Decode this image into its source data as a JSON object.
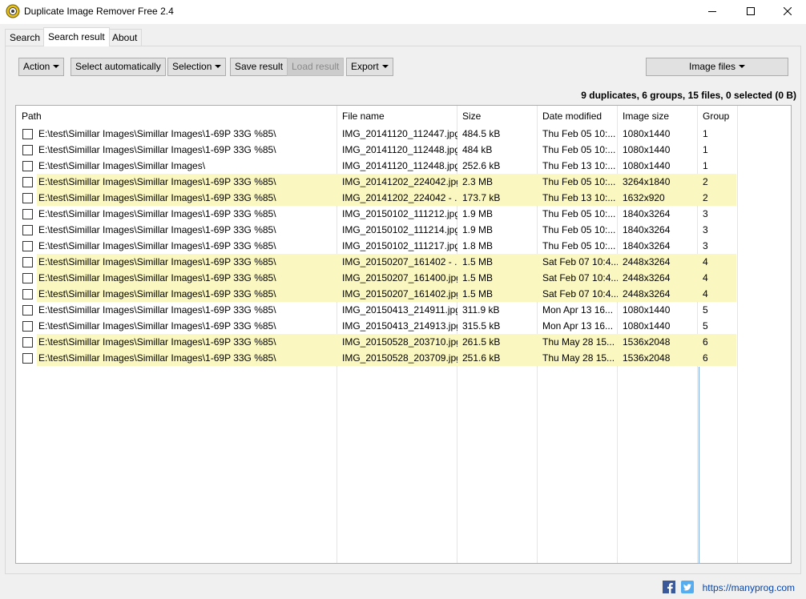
{
  "window": {
    "title": "Duplicate Image Remover Free 2.4"
  },
  "tabs": [
    {
      "label": "Search"
    },
    {
      "label": "Search result"
    },
    {
      "label": "About"
    }
  ],
  "toolbar": {
    "action": "Action",
    "select_auto": "Select automatically",
    "selection": "Selection",
    "save_result": "Save result",
    "load_result": "Load result",
    "export": "Export",
    "filter": "Image files"
  },
  "summary": "9 duplicates, 6 groups, 15 files, 0 selected (0 B)",
  "columns": [
    "Path",
    "File name",
    "Size",
    "Date modified",
    "Image size",
    "Group"
  ],
  "rows": [
    {
      "path": "E:\\test\\Simillar Images\\Simillar Images\\1-69P 33G %85\\",
      "file": "IMG_20141120_112447.jpg",
      "size": "484.5 kB",
      "date": "Thu Feb 05 10:...",
      "dim": "1080x1440",
      "group": "1",
      "hl": false
    },
    {
      "path": "E:\\test\\Simillar Images\\Simillar Images\\1-69P 33G %85\\",
      "file": "IMG_20141120_112448.jpg",
      "size": "484 kB",
      "date": "Thu Feb 05 10:...",
      "dim": "1080x1440",
      "group": "1",
      "hl": false
    },
    {
      "path": "E:\\test\\Simillar Images\\Simillar Images\\",
      "file": "IMG_20141120_112448.jpg",
      "size": "252.6 kB",
      "date": "Thu Feb 13 10:...",
      "dim": "1080x1440",
      "group": "1",
      "hl": false
    },
    {
      "path": "E:\\test\\Simillar Images\\Simillar Images\\1-69P 33G %85\\",
      "file": "IMG_20141202_224042.jpg",
      "size": "2.3 MB",
      "date": "Thu Feb 05 10:...",
      "dim": "3264x1840",
      "group": "2",
      "hl": true
    },
    {
      "path": "E:\\test\\Simillar Images\\Simillar Images\\1-69P 33G %85\\",
      "file": "IMG_20141202_224042 - ...",
      "size": "173.7 kB",
      "date": "Thu Feb 13 10:...",
      "dim": "1632x920",
      "group": "2",
      "hl": true
    },
    {
      "path": "E:\\test\\Simillar Images\\Simillar Images\\1-69P 33G %85\\",
      "file": "IMG_20150102_111212.jpg",
      "size": "1.9 MB",
      "date": "Thu Feb 05 10:...",
      "dim": "1840x3264",
      "group": "3",
      "hl": false
    },
    {
      "path": "E:\\test\\Simillar Images\\Simillar Images\\1-69P 33G %85\\",
      "file": "IMG_20150102_111214.jpg",
      "size": "1.9 MB",
      "date": "Thu Feb 05 10:...",
      "dim": "1840x3264",
      "group": "3",
      "hl": false
    },
    {
      "path": "E:\\test\\Simillar Images\\Simillar Images\\1-69P 33G %85\\",
      "file": "IMG_20150102_111217.jpg",
      "size": "1.8 MB",
      "date": "Thu Feb 05 10:...",
      "dim": "1840x3264",
      "group": "3",
      "hl": false
    },
    {
      "path": "E:\\test\\Simillar Images\\Simillar Images\\1-69P 33G %85\\",
      "file": "IMG_20150207_161402 - ...",
      "size": "1.5 MB",
      "date": "Sat Feb 07 10:4...",
      "dim": "2448x3264",
      "group": "4",
      "hl": true
    },
    {
      "path": "E:\\test\\Simillar Images\\Simillar Images\\1-69P 33G %85\\",
      "file": "IMG_20150207_161400.jpg",
      "size": "1.5 MB",
      "date": "Sat Feb 07 10:4...",
      "dim": "2448x3264",
      "group": "4",
      "hl": true
    },
    {
      "path": "E:\\test\\Simillar Images\\Simillar Images\\1-69P 33G %85\\",
      "file": "IMG_20150207_161402.jpg",
      "size": "1.5 MB",
      "date": "Sat Feb 07 10:4...",
      "dim": "2448x3264",
      "group": "4",
      "hl": true
    },
    {
      "path": "E:\\test\\Simillar Images\\Simillar Images\\1-69P 33G %85\\",
      "file": "IMG_20150413_214911.jpg",
      "size": "311.9 kB",
      "date": "Mon Apr 13 16...",
      "dim": "1080x1440",
      "group": "5",
      "hl": false
    },
    {
      "path": "E:\\test\\Simillar Images\\Simillar Images\\1-69P 33G %85\\",
      "file": "IMG_20150413_214913.jpg",
      "size": "315.5 kB",
      "date": "Mon Apr 13 16...",
      "dim": "1080x1440",
      "group": "5",
      "hl": false
    },
    {
      "path": "E:\\test\\Simillar Images\\Simillar Images\\1-69P 33G %85\\",
      "file": "IMG_20150528_203710.jpg",
      "size": "261.5 kB",
      "date": "Thu May 28 15...",
      "dim": "1536x2048",
      "group": "6",
      "hl": true
    },
    {
      "path": "E:\\test\\Simillar Images\\Simillar Images\\1-69P 33G %85\\",
      "file": "IMG_20150528_203709.jpg",
      "size": "251.6 kB",
      "date": "Thu May 28 15...",
      "dim": "1536x2048",
      "group": "6",
      "hl": true
    }
  ],
  "footer": {
    "link": "https://manyprog.com",
    "facebook_icon": "facebook-icon",
    "twitter_icon": "twitter-icon"
  },
  "colors": {
    "highlight": "#fbf7c0",
    "link": "#0645ad"
  }
}
